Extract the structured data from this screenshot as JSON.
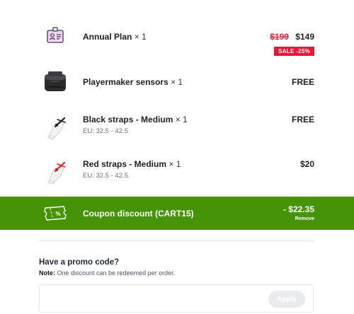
{
  "items": [
    {
      "name": "Annual Plan",
      "qty": "× 1",
      "subtitle": "",
      "icon": "id-badge-icon",
      "original_price": "$199",
      "price": "$149",
      "badge": "SALE  -25%"
    },
    {
      "name": "Playermaker sensors",
      "qty": " × 1",
      "subtitle": "",
      "icon": "sensor-device-icon",
      "price": "FREE"
    },
    {
      "name": "Black straps - Medium",
      "qty": " × 1",
      "subtitle": "EU: 32.5 - 42.5",
      "icon": "black-strap-boot-icon",
      "price": "FREE"
    },
    {
      "name": "Red straps - Medium",
      "qty": " × 1",
      "subtitle": "EU: 32.5 - 42.5",
      "icon": "red-strap-boot-icon",
      "price": "$20"
    }
  ],
  "coupon": {
    "icon": "coupon-ticket-icon",
    "icon_symbol": "%",
    "label": "Coupon discount (CART15)",
    "amount": "- $22.35",
    "remove_label": "Remove",
    "background": "#469306"
  },
  "promo": {
    "title": "Have a promo code?",
    "note_label": "Note:",
    "note_text": " One discount can be redeemed per order.",
    "input_value": "",
    "placeholder": "",
    "apply_label": "Apply"
  },
  "colors": {
    "sale_red": "#e8173a",
    "coupon_green": "#469306"
  }
}
